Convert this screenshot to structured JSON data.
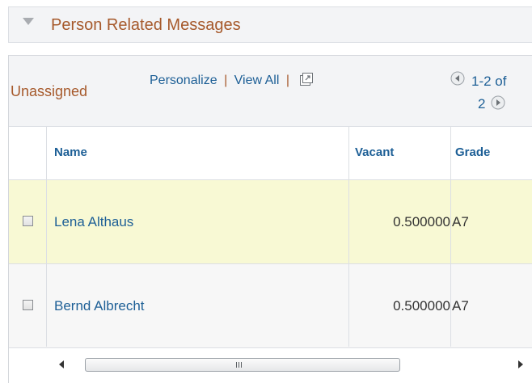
{
  "section": {
    "title": "Person Related Messages",
    "toggle_icon": "triangle-down-icon"
  },
  "grid": {
    "title": "Unassigned",
    "toolbar": {
      "personalize": "Personalize",
      "separator": "|",
      "view_all": "View All",
      "new_window_icon": "new-window-icon"
    },
    "pager": {
      "range_line1": "1-2 of",
      "range_line2": "2",
      "prev_icon": "previous-page-icon",
      "next_icon": "next-page-icon"
    },
    "columns": {
      "name": "Name",
      "vacant": "Vacant",
      "grade": "Grade"
    },
    "rows": [
      {
        "name": "Lena Althaus",
        "vacant": "0.500000",
        "grade": "A7"
      },
      {
        "name": "Bernd Albrecht",
        "vacant": "0.500000",
        "grade": "A7"
      }
    ],
    "scrollbar": {
      "left_icon": "scroll-left-icon",
      "right_icon": "scroll-right-icon",
      "grip_icon": "scroll-grip-icon"
    }
  },
  "colors": {
    "section_title": "#a6592b",
    "link": "#1d5f96",
    "highlight_row": "#f8f9d4",
    "header_bg": "#f3f4f6"
  }
}
